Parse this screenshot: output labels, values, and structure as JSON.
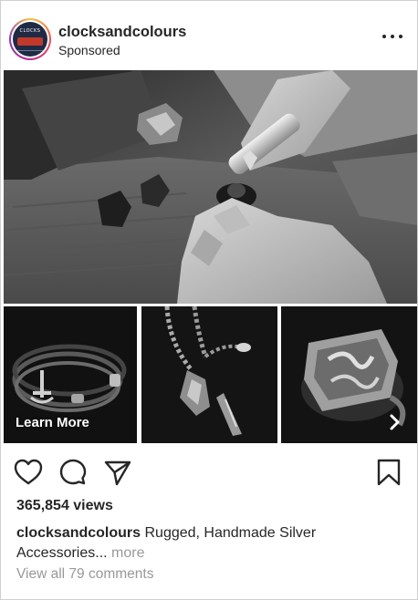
{
  "post": {
    "username": "clocksandcolours",
    "sponsored_label": "Sponsored",
    "cta_label": "Learn More",
    "views_label": "365,854 views",
    "caption_user": "clocksandcolours",
    "caption_text_1": " Rugged, Handmade Silver",
    "caption_text_2": "Accessories... ",
    "caption_more": "more",
    "comments_link": "View all 79 comments"
  },
  "icons": {
    "menu": "more-horizontal-icon",
    "like": "heart-outline-icon",
    "comment": "comment-bubble-icon",
    "share": "paper-plane-icon",
    "save": "bookmark-icon",
    "carousel_next": "chevron-right-icon"
  },
  "colors": {
    "text": "#262626",
    "muted": "#999999",
    "story_ring_start": "#f4c13d",
    "story_ring_end": "#bc2a8d"
  }
}
